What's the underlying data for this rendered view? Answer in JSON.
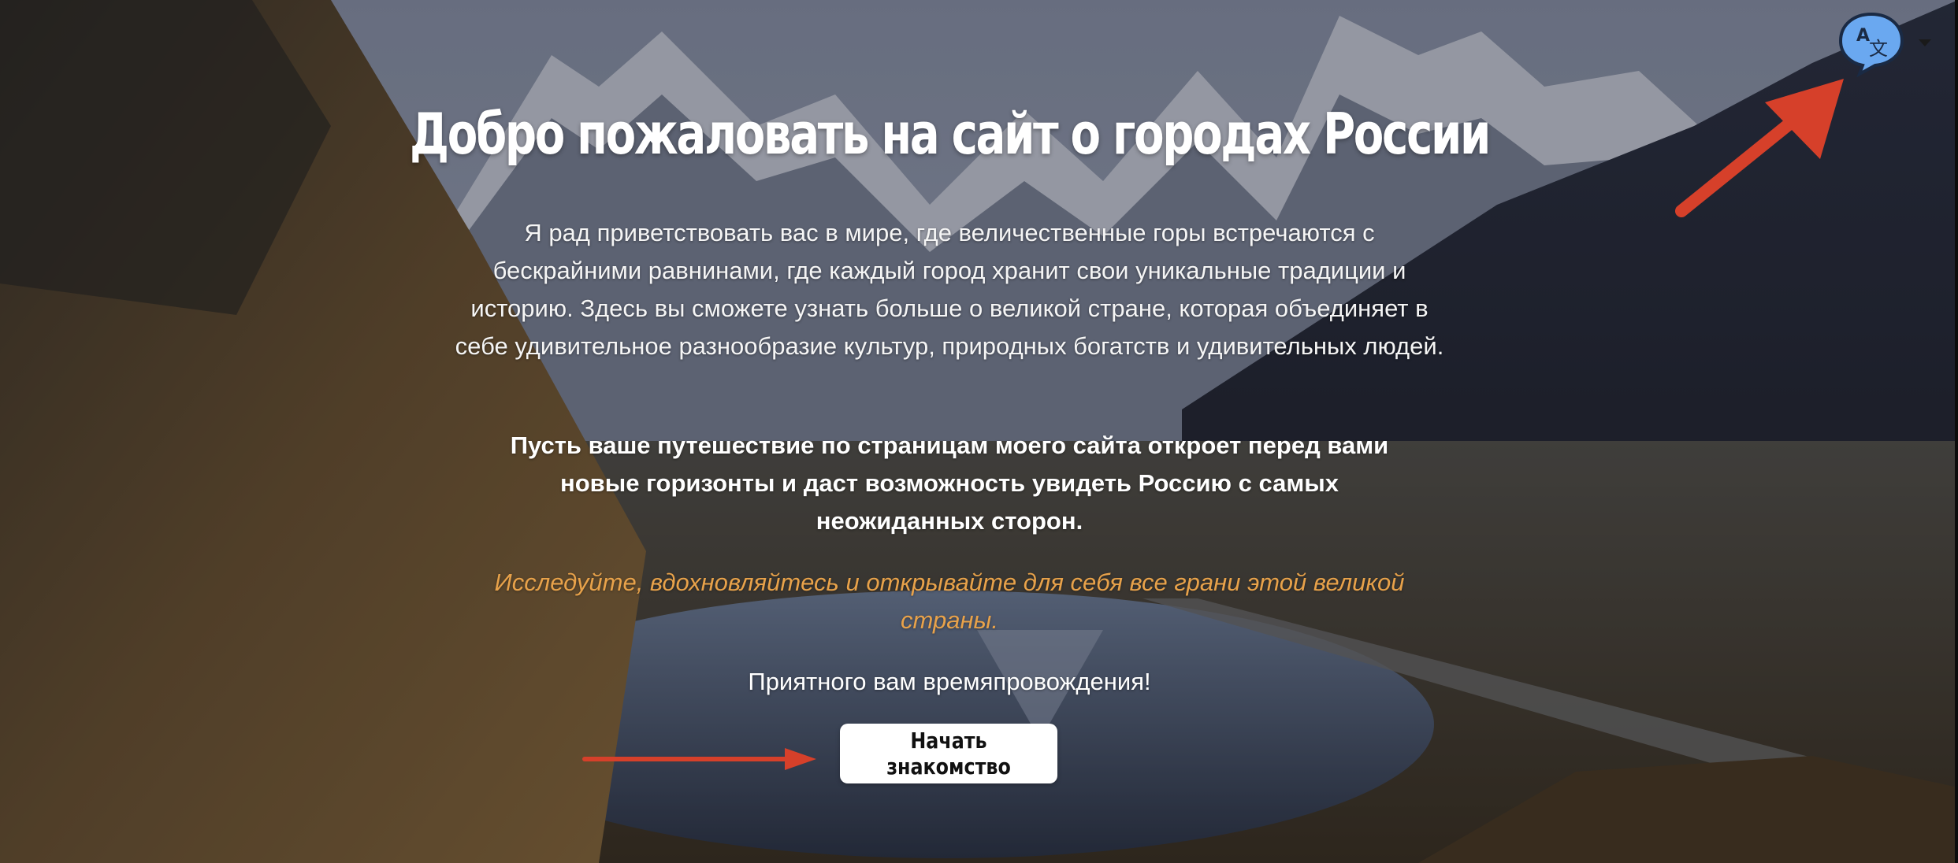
{
  "page": {
    "title": "Добро пожаловать на сайт о городах России",
    "intro": "Я рад приветствовать вас в мире, где величественные горы встречаются с бескрайними равнинами, где каждый город хранит свои уникальные традиции и историю. Здесь вы сможете узнать больше о великой стране, которая объединяет в себе удивительное разнообразие культур, природных богатств и удивительных людей.",
    "bold_text": "Пусть ваше путешествие по страницам моего сайта откроет перед вами новые горизонты и даст возможность увидеть Россию с самых неожиданных сторон.",
    "accent_text": "Исследуйте, вдохновляйтесь и открывайте для себя все грани этой великой страны.",
    "enjoy_text": "Приятного вам времяпровождения!",
    "start_button": "Начать знакомство"
  },
  "translate_widget": {
    "icon": "translate-icon",
    "glyph_latin": "A",
    "glyph_cjk": "文",
    "dropdown_icon": "chevron-down-icon"
  },
  "colors": {
    "accent_text": "#e8a24a",
    "annotation_arrow": "#d6402a",
    "translate_bubble": "#6aa8f0",
    "button_bg": "#ffffff"
  },
  "background": {
    "scene": "mountain-valley-lake-photo"
  }
}
